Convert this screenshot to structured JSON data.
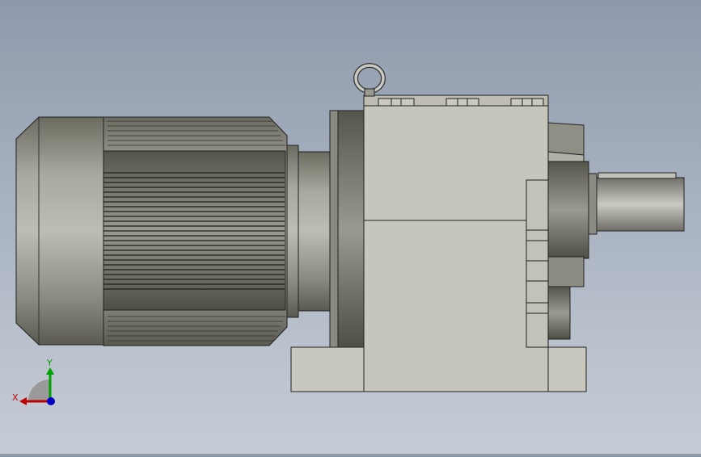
{
  "viewport": {
    "model": "gear-motor",
    "background_top": "#8e9aac",
    "background_bottom": "#c7cdd6"
  },
  "triad": {
    "x_label": "X",
    "y_label": "Y",
    "x_color": "#c00000",
    "y_color": "#00a000",
    "z_color": "#0000c0"
  }
}
